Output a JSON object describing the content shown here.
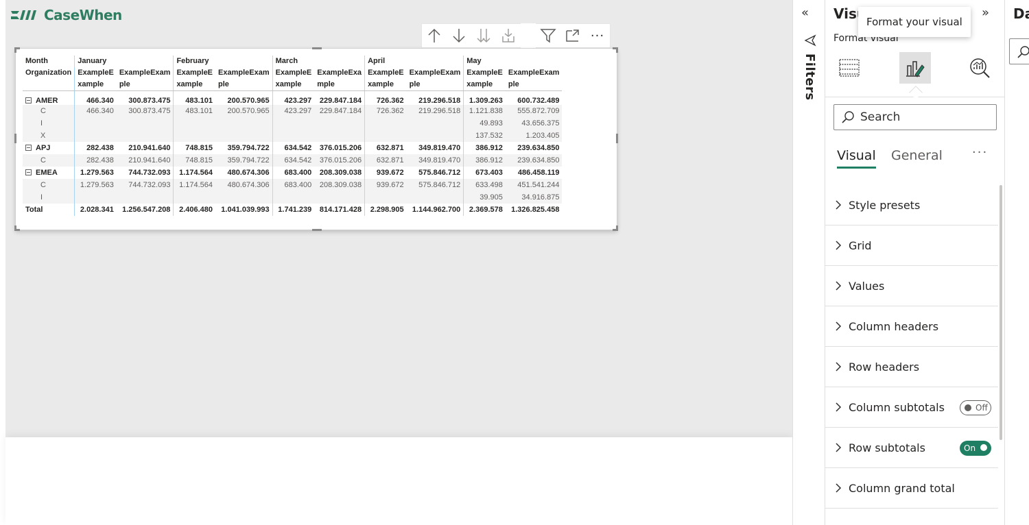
{
  "logo": {
    "text": "CaseWhen"
  },
  "visual_header": {
    "icons": [
      "arrow-up-icon",
      "arrow-down-icon",
      "double-arrow-down-icon",
      "expand-hierarchy-icon",
      "filter-icon",
      "focus-mode-icon",
      "more-options-icon"
    ],
    "more_label": "···"
  },
  "matrix": {
    "corner": {
      "row1": "Month",
      "row2": "Organization"
    },
    "months": [
      "January",
      "February",
      "March",
      "April",
      "May"
    ],
    "subheaders": [
      [
        "ExampleE",
        "xample"
      ],
      [
        "ExampleExam",
        "ple"
      ],
      [
        "ExampleE",
        "xample"
      ],
      [
        "ExampleExam",
        "ple"
      ],
      [
        "ExampleE",
        "xample"
      ],
      [
        "ExampleExa",
        "mple"
      ],
      [
        "ExampleE",
        "xample"
      ],
      [
        "ExampleExam",
        "ple"
      ],
      [
        "ExampleE",
        "xample"
      ],
      [
        "ExampleExam",
        "ple"
      ]
    ],
    "rows": [
      {
        "label": "AMER",
        "level": 0,
        "values": [
          "466.340",
          "300.873.475",
          "483.101",
          "200.570.965",
          "423.297",
          "229.847.184",
          "726.362",
          "219.296.518",
          "1.309.263",
          "600.732.489"
        ]
      },
      {
        "label": "C",
        "level": 1,
        "values": [
          "466.340",
          "300.873.475",
          "483.101",
          "200.570.965",
          "423.297",
          "229.847.184",
          "726.362",
          "219.296.518",
          "1.121.838",
          "555.872.709"
        ]
      },
      {
        "label": "I",
        "level": 1,
        "values": [
          "",
          "",
          "",
          "",
          "",
          "",
          "",
          "",
          "49.893",
          "43.656.375"
        ]
      },
      {
        "label": "X",
        "level": 1,
        "values": [
          "",
          "",
          "",
          "",
          "",
          "",
          "",
          "",
          "137.532",
          "1.203.405"
        ]
      },
      {
        "label": "APJ",
        "level": 0,
        "values": [
          "282.438",
          "210.941.640",
          "748.815",
          "359.794.722",
          "634.542",
          "376.015.206",
          "632.871",
          "349.819.470",
          "386.912",
          "239.634.850"
        ]
      },
      {
        "label": "C",
        "level": 1,
        "values": [
          "282.438",
          "210.941.640",
          "748.815",
          "359.794.722",
          "634.542",
          "376.015.206",
          "632.871",
          "349.819.470",
          "386.912",
          "239.634.850"
        ]
      },
      {
        "label": "EMEA",
        "level": 0,
        "values": [
          "1.279.563",
          "744.732.093",
          "1.174.564",
          "480.674.306",
          "683.400",
          "208.309.038",
          "939.672",
          "575.846.712",
          "673.403",
          "486.458.119"
        ]
      },
      {
        "label": "C",
        "level": 1,
        "values": [
          "1.279.563",
          "744.732.093",
          "1.174.564",
          "480.674.306",
          "683.400",
          "208.309.038",
          "939.672",
          "575.846.712",
          "633.498",
          "451.541.244"
        ]
      },
      {
        "label": "I",
        "level": 1,
        "values": [
          "",
          "",
          "",
          "",
          "",
          "",
          "",
          "",
          "39.905",
          "34.916.875"
        ]
      }
    ],
    "total": {
      "label": "Total",
      "values": [
        "2.028.341",
        "1.256.547.208",
        "2.406.480",
        "1.041.039.993",
        "1.741.239",
        "814.171.428",
        "2.298.905",
        "1.144.962.700",
        "2.369.578",
        "1.326.825.458"
      ]
    }
  },
  "filters_pane": {
    "label": "Filters",
    "collapse_glyph": "«"
  },
  "format_pane": {
    "title": "Visu",
    "expand_glyph": "»",
    "subtitle": "Format visual",
    "tooltip": "Format your visual",
    "search": {
      "placeholder": "Search",
      "value": ""
    },
    "tabs": {
      "visual": "Visual",
      "general": "General",
      "more": "···"
    },
    "sections": [
      {
        "label": "Style presets"
      },
      {
        "label": "Grid"
      },
      {
        "label": "Values"
      },
      {
        "label": "Column headers"
      },
      {
        "label": "Row headers"
      },
      {
        "label": "Column subtotals",
        "toggle": "Off"
      },
      {
        "label": "Row subtotals",
        "toggle": "On"
      },
      {
        "label": "Column grand total"
      }
    ]
  },
  "data_pane": {
    "title": "Da"
  },
  "colors": {
    "accent": "#1f7f62",
    "logo": "#2f7d61",
    "canvas": "#eaeaea"
  }
}
